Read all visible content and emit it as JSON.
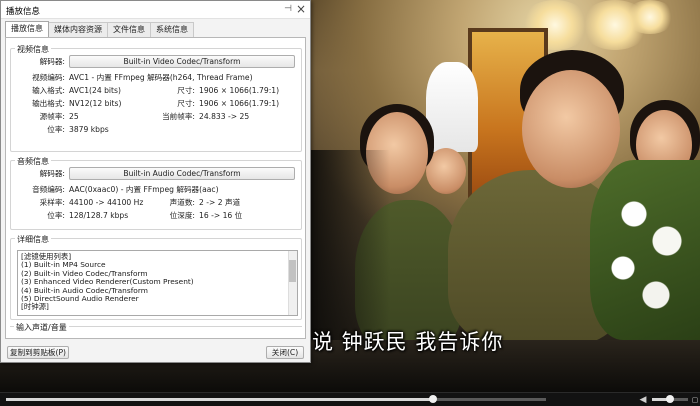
{
  "dialog": {
    "title": "播放信息",
    "pin_icon": "pin-icon",
    "close_icon": "close-icon",
    "tabs": [
      {
        "label": "播放信息",
        "active": true
      },
      {
        "label": "媒体内容资源",
        "active": false
      },
      {
        "label": "文件信息",
        "active": false
      },
      {
        "label": "系统信息",
        "active": false
      }
    ],
    "video_info": {
      "title": "视频信息",
      "decoder_label": "解码器:",
      "decoder_button": "Built-in Video Codec/Transform",
      "codec_label": "视频编码:",
      "codec_value": "AVC1 - 内置 FFmpeg 解码器(h264, Thread Frame)",
      "input_format_label": "输入格式:",
      "input_format_value": "AVC1(24 bits)",
      "input_size_label": "尺寸:",
      "input_size_value": "1906 × 1066(1.79:1)",
      "output_format_label": "输出格式:",
      "output_format_value": "NV12(12 bits)",
      "output_size_label": "尺寸:",
      "output_size_value": "1906 × 1066(1.79:1)",
      "source_fps_label": "源帧率:",
      "source_fps_value": "25",
      "current_fps_label": "当前帧率:",
      "current_fps_value": "24.833 -> 25",
      "bitrate_label": "位率:",
      "bitrate_value": "3879 kbps"
    },
    "audio_info": {
      "title": "音频信息",
      "decoder_label": "解码器:",
      "decoder_button": "Built-in Audio Codec/Transform",
      "codec_label": "音频编码:",
      "codec_value": "AAC(0xaac0) - 内置 FFmpeg 解码器(aac)",
      "sample_rate_label": "采样率:",
      "sample_rate_value": "44100 -> 44100 Hz",
      "channels_label": "声道数:",
      "channels_value": "2 -> 2 声道",
      "bitrate_label": "位率:",
      "bitrate_value": "128/128.7 kbps",
      "bit_depth_label": "位深度:",
      "bit_depth_value": "16 -> 16 位"
    },
    "details": {
      "title": "详细信息",
      "lines": [
        "[滤镜使用列表]",
        "(1) Built-in MP4 Source",
        "(2) Built-in Video Codec/Transform",
        "(3) Enhanced Video Renderer(Custom Present)",
        "(4) Built-in Audio Codec/Transform",
        "(5) DirectSound Audio Renderer",
        "",
        "[时钟源]"
      ]
    },
    "input_channel_title": "输入声道/音量",
    "copy_button": "复制到剪贴板(P)",
    "close_button": "关闭(C)"
  },
  "video": {
    "subtitle": "说 钟跃民 我告诉你"
  },
  "player": {
    "seek_progress": 0.79,
    "volume_level": 0.5,
    "icons": [
      "speaker-icon",
      "fullscreen-icon"
    ]
  }
}
